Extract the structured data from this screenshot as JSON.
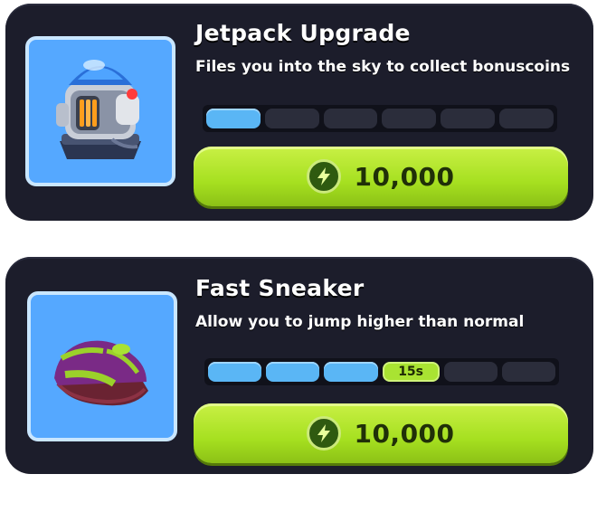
{
  "items": [
    {
      "title": "Jetpack Upgrade",
      "description": "Files you into the sky to collect bonuscoins",
      "progress": {
        "filled": 1,
        "total": 6,
        "timer_label": ""
      },
      "price": "10,000",
      "icon": "jetpack-icon"
    },
    {
      "title": "Fast Sneaker",
      "description": "Allow you to jump higher than normal",
      "progress": {
        "filled": 3,
        "total": 6,
        "timer_label": "15s"
      },
      "price": "10,000",
      "icon": "sneaker-icon"
    }
  ],
  "colors": {
    "card_bg": "#1c1d2b",
    "thumb_bg": "#55a8ff",
    "segment_filled": "#5ab6f5",
    "segment_empty": "#2b2d3b",
    "button": "#a6e020",
    "coin": "#2f5a10"
  }
}
